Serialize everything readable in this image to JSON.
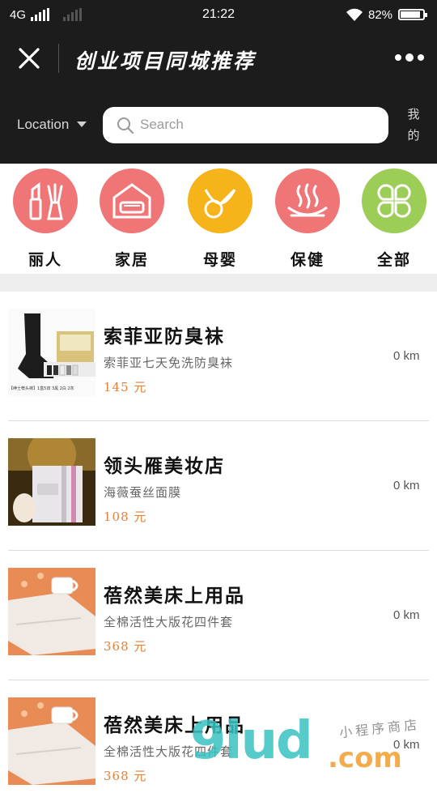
{
  "status": {
    "network": "4G",
    "time": "21:22",
    "battery": "82%"
  },
  "header": {
    "title": "创业项目同城推荐"
  },
  "search": {
    "location": "Location",
    "placeholder": "Search",
    "mine_label": "我的"
  },
  "categories": [
    {
      "label": "丽人",
      "color": "#f07576",
      "icon": "lipstick-icon"
    },
    {
      "label": "家居",
      "color": "#f07576",
      "icon": "sofa-icon"
    },
    {
      "label": "母婴",
      "color": "#f6b41a",
      "icon": "pacifier-icon"
    },
    {
      "label": "保健",
      "color": "#f07576",
      "icon": "spa-icon"
    },
    {
      "label": "全部",
      "color": "#9ccd57",
      "icon": "clover-icon"
    }
  ],
  "items": [
    {
      "name": "索菲亚防臭袜",
      "desc": "索菲亚七天免洗防臭袜",
      "price": "145 元",
      "distance": "0 km",
      "thumb_caption": "【绅士荐头袜】1盒5双  3黑 2白 2灰"
    },
    {
      "name": "领头雁美妆店",
      "desc": "海薇蚕丝面膜",
      "price": "108 元",
      "distance": "0 km"
    },
    {
      "name": "蓓然美床上用品",
      "desc": "全棉活性大版花四件套",
      "price": "368 元",
      "distance": "0 km"
    },
    {
      "name": "蓓然美床上用品",
      "desc": "全棉活性大版花四件套",
      "price": "368 元",
      "distance": "0 km"
    }
  ],
  "watermark": {
    "brand": "9lud",
    "domain": ".com",
    "tagline": "小程序商店"
  },
  "colors": {
    "bar": "#1c1c1c",
    "price": "#e0813c",
    "divider_band": "#eeeeee"
  }
}
